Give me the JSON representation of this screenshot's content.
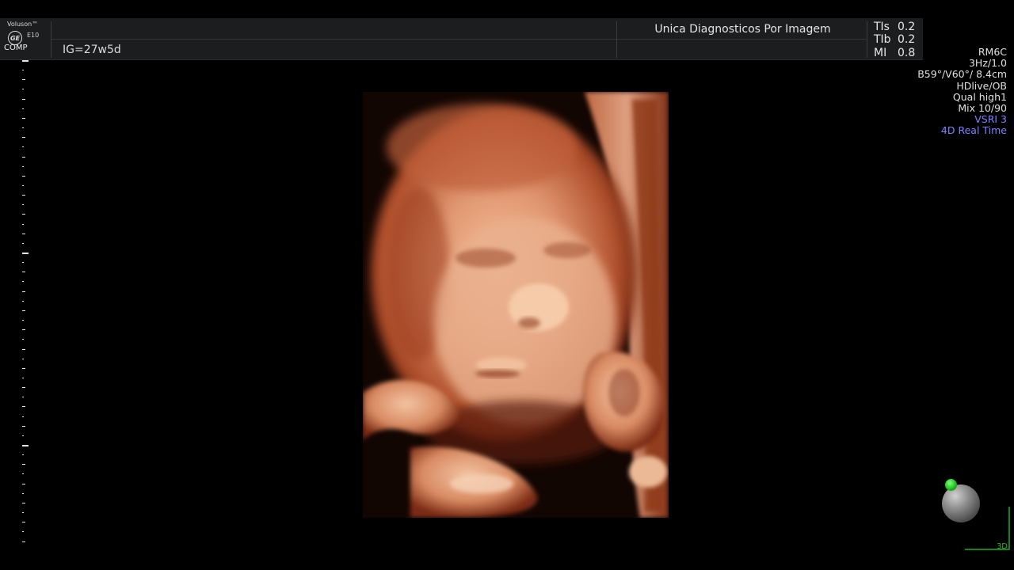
{
  "header": {
    "brand": "Voluson™",
    "logo_text": "GE",
    "model": "E10",
    "mode_tag": "COMP",
    "gestational_age": "IG=27w5d",
    "clinic_name": "Unica Diagnosticos Por Imagem",
    "indices": [
      {
        "label": "TIs",
        "value": "0.2"
      },
      {
        "label": "TIb",
        "value": "0.2"
      },
      {
        "label": "MI",
        "value": "0.8"
      }
    ]
  },
  "params": {
    "probe": "RM6C",
    "frequency": "3Hz/1.0",
    "angles": "B59°/V60°/ 8.4cm",
    "preset": "HDlive/OB",
    "quality": "Qual high1",
    "mix": "Mix 10/90",
    "vsri": "VSRI 3",
    "mode": "4D Real Time"
  },
  "orientation": {
    "label": "3D",
    "colors": {
      "indicator": "#17b817",
      "accent_text": "#8080ff"
    }
  },
  "image": {
    "subject": "3D ultrasound render of fetal face",
    "palette": {
      "skin": "#e7a27f",
      "shadow": "#5a1a08",
      "background": "#120603"
    }
  }
}
